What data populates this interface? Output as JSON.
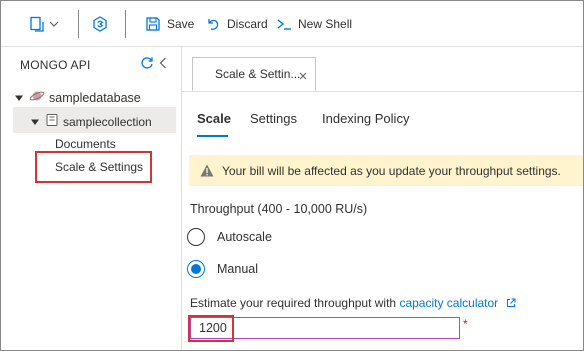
{
  "toolbar": {
    "save_label": "Save",
    "discard_label": "Discard",
    "new_shell_label": "New Shell"
  },
  "sidebar": {
    "title": "MONGO API",
    "database": "sampledatabase",
    "collection": "samplecollection",
    "items": [
      {
        "label": "Documents"
      },
      {
        "label": "Scale & Settings"
      }
    ]
  },
  "tabs": [
    {
      "label": "Scale & Settin..."
    }
  ],
  "subtabs": {
    "scale": "Scale",
    "settings": "Settings",
    "indexing": "Indexing Policy"
  },
  "warning": {
    "text": "Your bill will be affected as you update your throughput settings."
  },
  "throughput": {
    "label": "Throughput (400 - 10,000 RU/s)",
    "option_autoscale": "Autoscale",
    "option_manual": "Manual",
    "selected": "Manual",
    "estimate_text": "Estimate your required throughput with ",
    "link_text": "capacity calculator",
    "value": "1200",
    "required_mark": "*"
  },
  "colors": {
    "accent": "#0078d4",
    "highlight_box": "#d13438",
    "warning_bg": "#fff4ce"
  }
}
